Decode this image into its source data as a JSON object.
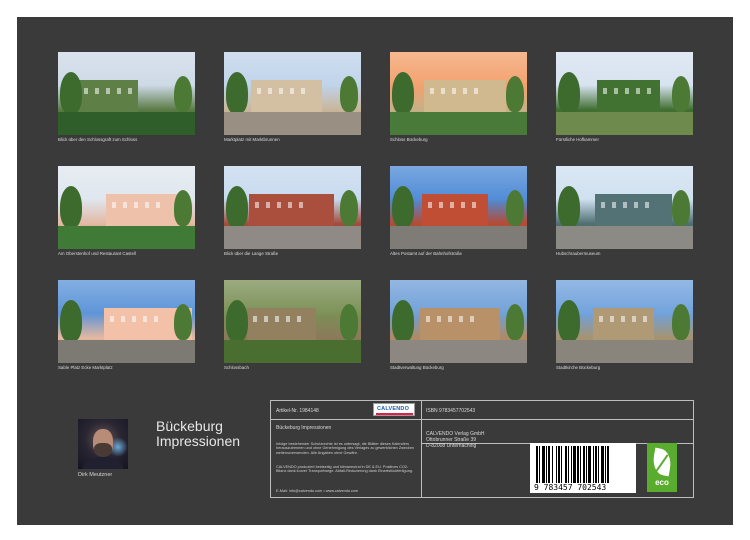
{
  "calendar": {
    "title": "Bückeburg Impressionen",
    "author": "Dirk Meutzner"
  },
  "photos": [
    {
      "caption": "Blick über den Schlossgraft zum Schloss",
      "colors": {
        "sky": "#cdd9e6",
        "ground": "#2f5e2a",
        "main": "#5a7a44"
      }
    },
    {
      "caption": "Marktplatz mit Marktbrunnen",
      "colors": {
        "sky": "#bfd3ea",
        "ground": "#9a8f83",
        "main": "#c9b69a"
      }
    },
    {
      "caption": "Schloss Bückeburg",
      "colors": {
        "sky": "#f3a06c",
        "ground": "#497a3a",
        "main": "#c7b088"
      }
    },
    {
      "caption": "Fürstliche Hofkammer",
      "colors": {
        "sky": "#d6e2ef",
        "ground": "#6e8a4c",
        "main": "#3f6d2f"
      }
    },
    {
      "caption": "Am Oberstenhof und Restaurant Castell",
      "colors": {
        "sky": "#dfe6ee",
        "ground": "#3f7b36",
        "main": "#e3b8a2"
      }
    },
    {
      "caption": "Blick über die Lange Straße",
      "colors": {
        "sky": "#c6d9ee",
        "ground": "#8f8a86",
        "main": "#a24a3a"
      }
    },
    {
      "caption": "Altes Postamt auf der Bahnhofstraße",
      "colors": {
        "sky": "#4d8ad6",
        "ground": "#7f7c78",
        "main": "#b64a32"
      }
    },
    {
      "caption": "Hubschraubermuseum",
      "colors": {
        "sky": "#cfe0f0",
        "ground": "#8b8a84",
        "main": "#4e6d70"
      }
    },
    {
      "caption": "Sable Platz Ecke Marktplatz",
      "colors": {
        "sky": "#5b93d8",
        "ground": "#7d7a74",
        "main": "#e6b8a0"
      }
    },
    {
      "caption": "Schlossbach",
      "colors": {
        "sky": "#7a8f55",
        "ground": "#4a6e2f",
        "main": "#8c7a5a"
      }
    },
    {
      "caption": "Stadtverwaltung Bückeburg",
      "colors": {
        "sky": "#6f9fd8",
        "ground": "#8c8780",
        "main": "#b08a64"
      }
    },
    {
      "caption": "Stadtkirche Bückeburg",
      "colors": {
        "sky": "#6fa1dc",
        "ground": "#8a857c",
        "main": "#a89370"
      }
    }
  ],
  "info": {
    "article_nr": "Artikel-Nr. 1984148",
    "calvendo_logo": "CALVENDO",
    "subtitle": "Bückeburg Impressionen",
    "legal_text": "Infolge bestehender Schutzrechte ist es untersagt, die Blätter dieses Kalenders herauszutrennen und ohne Genehmigung des Verlages zu gewerblichen Zwecken weiterzuverwenden. Alle Angaben ohne Gewähr.",
    "production_text": "CALVENDO produziert beidseitig und klimaneutral in DE & EU. Positives CO2-Bilanz dank kurzer Transportwege. Abfall-Reduzierung dank Einzelstückfertigung.",
    "contact": "E-Mail: info@calvendo.com • www.calvendo.com",
    "isbn": "ISBN 9783457702543",
    "publisher_name": "CALVENDO Verlag GmbH",
    "publisher_street": "Ottobrunner Straße 39",
    "publisher_city": "D-82008 Unterhaching",
    "barcode_number": "9 783457 702543",
    "eco_label": "eco"
  },
  "colors": {
    "background": "#3a3a3a",
    "eco_green": "#5aac2e",
    "calvendo_blue": "#1b5ea6",
    "calvendo_red": "#e11d48"
  }
}
